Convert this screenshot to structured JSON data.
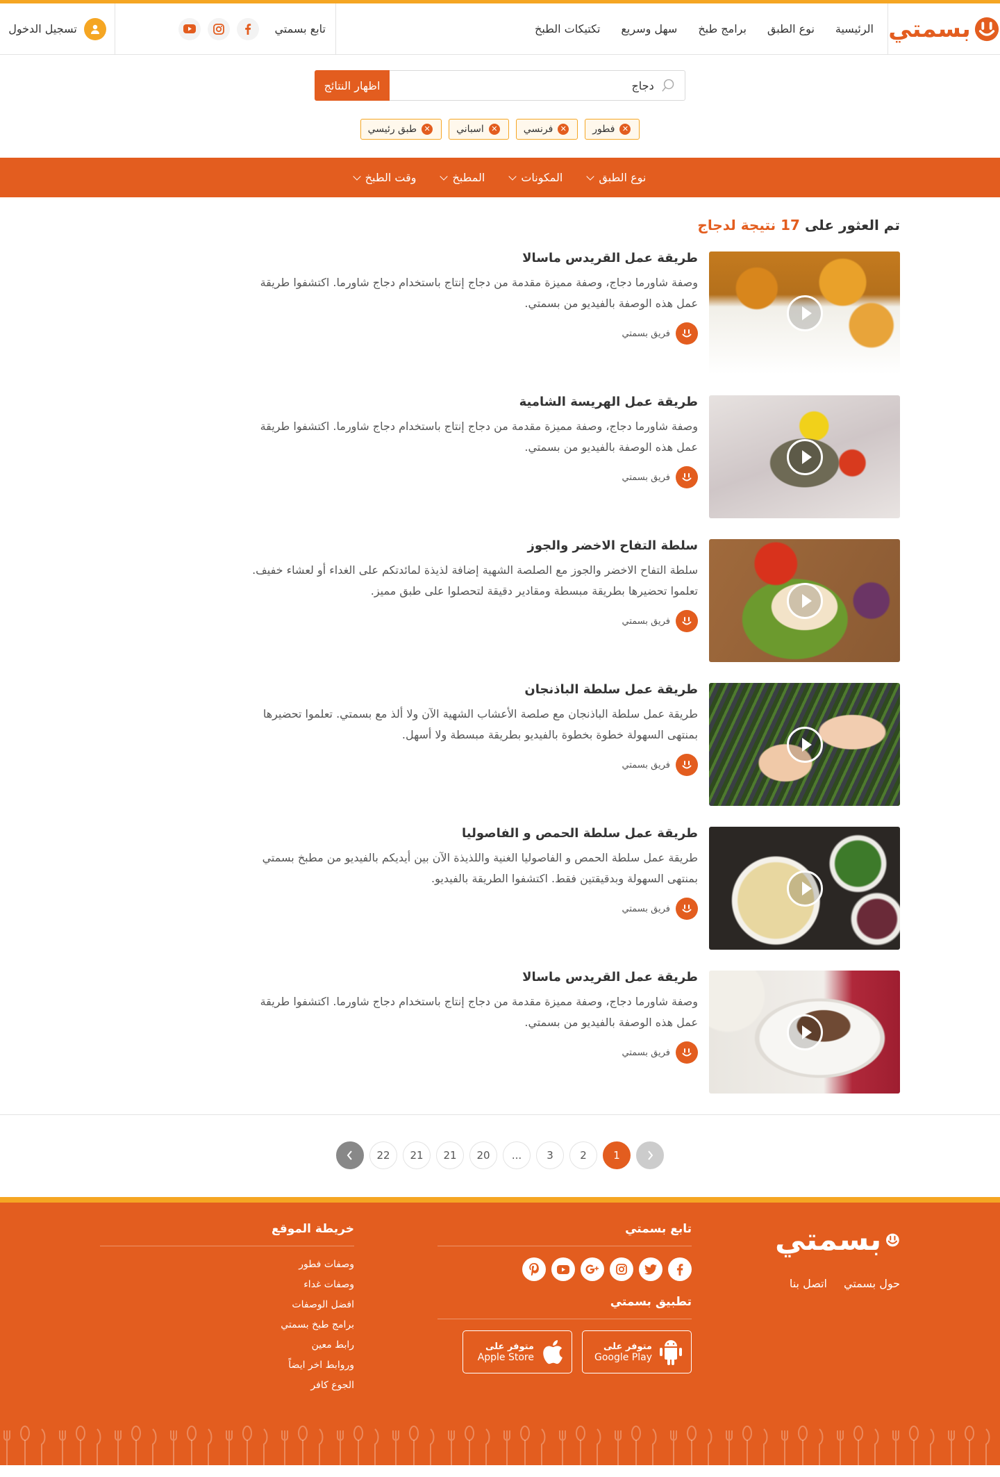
{
  "brand": {
    "name": "بسمتي",
    "accent": "#E35D1F",
    "secondary": "#F5A623"
  },
  "nav": [
    "الرئيسية",
    "نوع الطبق",
    "برامج طبخ",
    "سهل وسريع",
    "تكتيكات الطبخ"
  ],
  "follow_label": "تابع بسمتي",
  "login_label": "تسجيل الدخول",
  "search": {
    "value": "دجاج",
    "button": "اظهار النتائج"
  },
  "tags": [
    "فطور",
    "فرنسي",
    "اسباني",
    "طبق رئيسي"
  ],
  "filters": [
    "نوع الطبق",
    "المكونات",
    "المطبخ",
    "وقت الطبخ"
  ],
  "results": {
    "prefix": "تم العثور على",
    "count_text": "17 نتيجة لدجاج"
  },
  "recipes": [
    {
      "title": "طريقة عمل القريدس ماسالا",
      "desc": "وصفة شاورما دجاج، وصفة مميزة مقدمة من دجاج إنتاج باستخدام دجاج شاورما. اكتشفوا طريقة عمل هذه الوصفة بالفيديو من بسمتي.",
      "author": "فريق بسمتي"
    },
    {
      "title": "طريقة عمل الهريسة الشامية",
      "desc": "وصفة شاورما دجاج، وصفة مميزة مقدمة من دجاج إنتاج باستخدام دجاج شاورما. اكتشفوا طريقة عمل هذه الوصفة بالفيديو من بسمتي.",
      "author": "فريق بسمتي"
    },
    {
      "title": "سلطة التفاح الاخضر والجوز",
      "desc": "سلطة التفاح الاخضر والجوز مع الصلصة الشهية إضافة لذيذة لمائدتكم على الغداء أو لعشاء خفيف. تعلموا تحضيرها بطريقة مبسطة ومقادير دقيقة لتحصلوا على طبق مميز.",
      "author": "فريق بسمتي"
    },
    {
      "title": "طريقة عمل سلطة الباذنجان",
      "desc": "طريقة عمل سلطة الباذنجان مع صلصة الأعشاب الشهية الآن ولا ألذ مع بسمتي. تعلموا تحضيرها بمنتهى السهولة خطوة بخطوة بالفيديو بطريقة مبسطة ولا أسهل.",
      "author": "فريق بسمتي"
    },
    {
      "title": "طريقة عمل سلطة الحمص و الفاصوليا",
      "desc": "طريقة عمل سلطة الحمص و الفاصوليا الغنية واللذيذة الآن بين أيديكم بالفيديو من مطبخ بسمتي بمنتهى السهولة وبدقيقتين فقط. اكتشفوا الطريقة بالفيديو.",
      "author": "فريق بسمتي"
    },
    {
      "title": "طريقة عمل القريدس ماسالا",
      "desc": "وصفة شاورما دجاج، وصفة مميزة مقدمة من دجاج إنتاج باستخدام دجاج شاورما. اكتشفوا طريقة عمل هذه الوصفة بالفيديو من بسمتي.",
      "author": "فريق بسمتي"
    }
  ],
  "pagination": [
    "1",
    "2",
    "3",
    "...",
    "20",
    "21",
    "21",
    "22"
  ],
  "footer": {
    "links": [
      "حول بسمتي",
      "اتصل بنا"
    ],
    "follow_title": "تابع بسمتي",
    "app_title": "تطبيق بسمتي",
    "stores": [
      {
        "line1": "متوفر على",
        "line2": "Google Play",
        "icon": "android-icon"
      },
      {
        "line1": "متوفر على",
        "line2": "Apple Store",
        "icon": "apple-icon"
      }
    ],
    "sitemap_title": "خريطة الموقع",
    "sitemap": [
      "وصفات فطور",
      "وصفات غداء",
      "افضل الوصفات",
      "برامج طبخ بسمتي",
      "رابط معين",
      "وروابط اخر ايضاً",
      "الجوع كافر"
    ]
  }
}
